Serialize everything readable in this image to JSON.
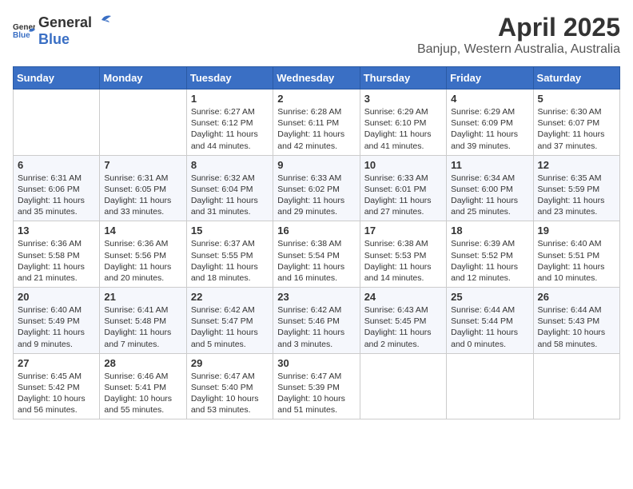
{
  "header": {
    "logo_general": "General",
    "logo_blue": "Blue",
    "month_year": "April 2025",
    "location": "Banjup, Western Australia, Australia"
  },
  "weekdays": [
    "Sunday",
    "Monday",
    "Tuesday",
    "Wednesday",
    "Thursday",
    "Friday",
    "Saturday"
  ],
  "weeks": [
    [
      {
        "day": "",
        "info": ""
      },
      {
        "day": "",
        "info": ""
      },
      {
        "day": "1",
        "info": "Sunrise: 6:27 AM\nSunset: 6:12 PM\nDaylight: 11 hours and 44 minutes."
      },
      {
        "day": "2",
        "info": "Sunrise: 6:28 AM\nSunset: 6:11 PM\nDaylight: 11 hours and 42 minutes."
      },
      {
        "day": "3",
        "info": "Sunrise: 6:29 AM\nSunset: 6:10 PM\nDaylight: 11 hours and 41 minutes."
      },
      {
        "day": "4",
        "info": "Sunrise: 6:29 AM\nSunset: 6:09 PM\nDaylight: 11 hours and 39 minutes."
      },
      {
        "day": "5",
        "info": "Sunrise: 6:30 AM\nSunset: 6:07 PM\nDaylight: 11 hours and 37 minutes."
      }
    ],
    [
      {
        "day": "6",
        "info": "Sunrise: 6:31 AM\nSunset: 6:06 PM\nDaylight: 11 hours and 35 minutes."
      },
      {
        "day": "7",
        "info": "Sunrise: 6:31 AM\nSunset: 6:05 PM\nDaylight: 11 hours and 33 minutes."
      },
      {
        "day": "8",
        "info": "Sunrise: 6:32 AM\nSunset: 6:04 PM\nDaylight: 11 hours and 31 minutes."
      },
      {
        "day": "9",
        "info": "Sunrise: 6:33 AM\nSunset: 6:02 PM\nDaylight: 11 hours and 29 minutes."
      },
      {
        "day": "10",
        "info": "Sunrise: 6:33 AM\nSunset: 6:01 PM\nDaylight: 11 hours and 27 minutes."
      },
      {
        "day": "11",
        "info": "Sunrise: 6:34 AM\nSunset: 6:00 PM\nDaylight: 11 hours and 25 minutes."
      },
      {
        "day": "12",
        "info": "Sunrise: 6:35 AM\nSunset: 5:59 PM\nDaylight: 11 hours and 23 minutes."
      }
    ],
    [
      {
        "day": "13",
        "info": "Sunrise: 6:36 AM\nSunset: 5:58 PM\nDaylight: 11 hours and 21 minutes."
      },
      {
        "day": "14",
        "info": "Sunrise: 6:36 AM\nSunset: 5:56 PM\nDaylight: 11 hours and 20 minutes."
      },
      {
        "day": "15",
        "info": "Sunrise: 6:37 AM\nSunset: 5:55 PM\nDaylight: 11 hours and 18 minutes."
      },
      {
        "day": "16",
        "info": "Sunrise: 6:38 AM\nSunset: 5:54 PM\nDaylight: 11 hours and 16 minutes."
      },
      {
        "day": "17",
        "info": "Sunrise: 6:38 AM\nSunset: 5:53 PM\nDaylight: 11 hours and 14 minutes."
      },
      {
        "day": "18",
        "info": "Sunrise: 6:39 AM\nSunset: 5:52 PM\nDaylight: 11 hours and 12 minutes."
      },
      {
        "day": "19",
        "info": "Sunrise: 6:40 AM\nSunset: 5:51 PM\nDaylight: 11 hours and 10 minutes."
      }
    ],
    [
      {
        "day": "20",
        "info": "Sunrise: 6:40 AM\nSunset: 5:49 PM\nDaylight: 11 hours and 9 minutes."
      },
      {
        "day": "21",
        "info": "Sunrise: 6:41 AM\nSunset: 5:48 PM\nDaylight: 11 hours and 7 minutes."
      },
      {
        "day": "22",
        "info": "Sunrise: 6:42 AM\nSunset: 5:47 PM\nDaylight: 11 hours and 5 minutes."
      },
      {
        "day": "23",
        "info": "Sunrise: 6:42 AM\nSunset: 5:46 PM\nDaylight: 11 hours and 3 minutes."
      },
      {
        "day": "24",
        "info": "Sunrise: 6:43 AM\nSunset: 5:45 PM\nDaylight: 11 hours and 2 minutes."
      },
      {
        "day": "25",
        "info": "Sunrise: 6:44 AM\nSunset: 5:44 PM\nDaylight: 11 hours and 0 minutes."
      },
      {
        "day": "26",
        "info": "Sunrise: 6:44 AM\nSunset: 5:43 PM\nDaylight: 10 hours and 58 minutes."
      }
    ],
    [
      {
        "day": "27",
        "info": "Sunrise: 6:45 AM\nSunset: 5:42 PM\nDaylight: 10 hours and 56 minutes."
      },
      {
        "day": "28",
        "info": "Sunrise: 6:46 AM\nSunset: 5:41 PM\nDaylight: 10 hours and 55 minutes."
      },
      {
        "day": "29",
        "info": "Sunrise: 6:47 AM\nSunset: 5:40 PM\nDaylight: 10 hours and 53 minutes."
      },
      {
        "day": "30",
        "info": "Sunrise: 6:47 AM\nSunset: 5:39 PM\nDaylight: 10 hours and 51 minutes."
      },
      {
        "day": "",
        "info": ""
      },
      {
        "day": "",
        "info": ""
      },
      {
        "day": "",
        "info": ""
      }
    ]
  ]
}
